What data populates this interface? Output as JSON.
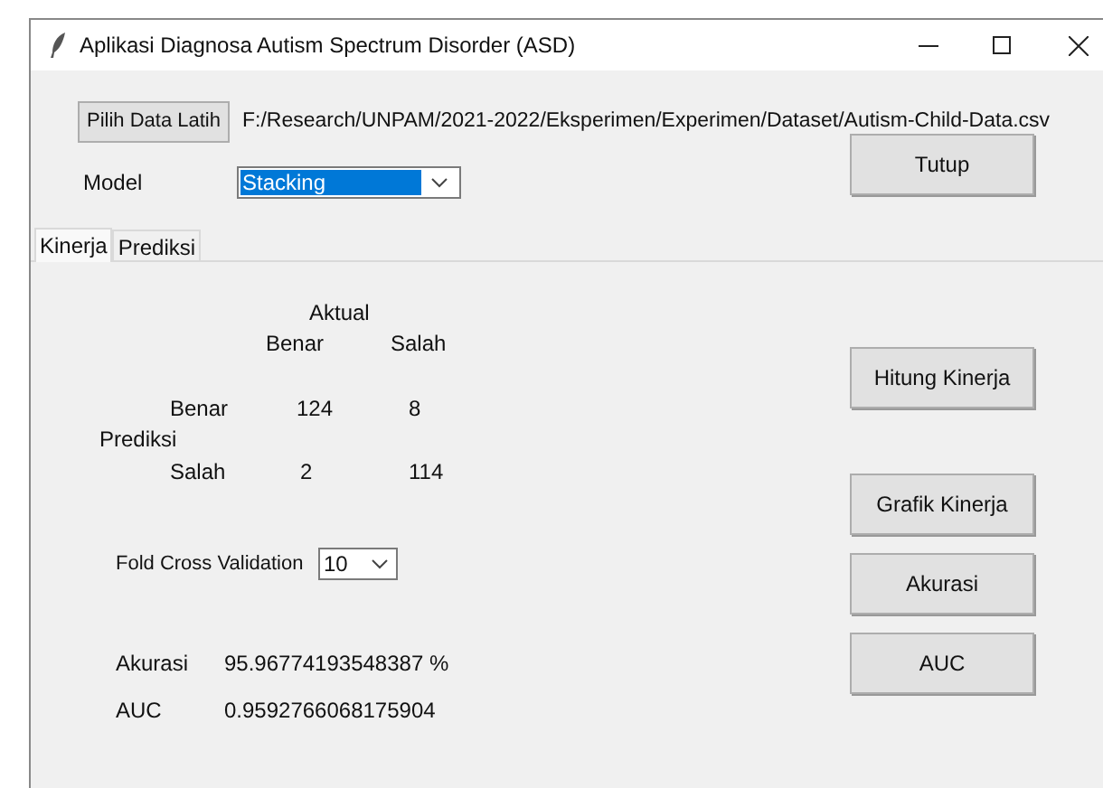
{
  "window": {
    "title": "Aplikasi Diagnosa Autism Spectrum Disorder (ASD)"
  },
  "data_file": {
    "button": "Pilih Data Latih",
    "path": "F:/Research/UNPAM/2021-2022/Eksperimen/Experimen/Dataset/Autism-Child-Data.csv"
  },
  "model": {
    "label": "Model",
    "value": "Stacking"
  },
  "close_button": "Tutup",
  "tabs": [
    {
      "label": "Kinerja",
      "selected": true
    },
    {
      "label": "Prediksi",
      "selected": false
    }
  ],
  "confusion_matrix": {
    "actual_label": "Aktual",
    "predicted_label": "Prediksi",
    "columns": [
      "Benar",
      "Salah"
    ],
    "rows": [
      {
        "label": "Benar",
        "values": [
          "124",
          "8"
        ]
      },
      {
        "label": "Salah",
        "values": [
          "2",
          "114"
        ]
      }
    ]
  },
  "fold": {
    "label": "Fold Cross Validation",
    "value": "10"
  },
  "results": [
    {
      "label": "Akurasi",
      "value": "95.96774193548387 %"
    },
    {
      "label": "AUC",
      "value": "0.9592766068175904"
    }
  ],
  "actions": [
    "Hitung Kinerja",
    "Grafik Kinerja",
    "Akurasi",
    "AUC"
  ]
}
